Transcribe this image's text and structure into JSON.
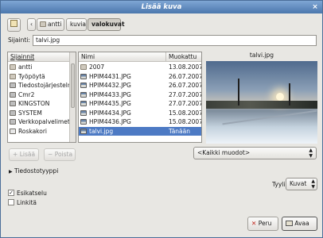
{
  "window": {
    "title": "Lisää kuva"
  },
  "path_bar": {
    "crumbs": [
      "antti",
      "kuvia",
      "valokuvat"
    ],
    "active": "valokuvat"
  },
  "location": {
    "label": "Sijainti:",
    "value": "talvi.jpg"
  },
  "places": {
    "header": "Sijainnit",
    "items": [
      {
        "label": "antti",
        "icon": "home-folder-icon"
      },
      {
        "label": "Työpöytä",
        "icon": "desktop-icon"
      },
      {
        "label": "Tiedostojärjestelm",
        "icon": "filesystem-icon"
      },
      {
        "label": "Cmr2",
        "icon": "drive-icon"
      },
      {
        "label": "KINGSTON",
        "icon": "usb-drive-icon"
      },
      {
        "label": "SYSTEM",
        "icon": "drive-icon"
      },
      {
        "label": "Verkkopalvelimet",
        "icon": "network-icon"
      },
      {
        "label": "Roskakori",
        "icon": "trash-icon"
      }
    ],
    "add_label": "Lisää",
    "remove_label": "Poista"
  },
  "files": {
    "col_name": "Nimi",
    "col_modified": "Muokattu",
    "rows": [
      {
        "name": "2007",
        "modified": "13.08.2007",
        "type": "folder"
      },
      {
        "name": "HPIM4431.JPG",
        "modified": "26.07.2007",
        "type": "image"
      },
      {
        "name": "HPIM4432.JPG",
        "modified": "26.07.2007",
        "type": "image"
      },
      {
        "name": "HPIM4433.JPG",
        "modified": "27.07.2007",
        "type": "image"
      },
      {
        "name": "HPIM4435.JPG",
        "modified": "27.07.2007",
        "type": "image"
      },
      {
        "name": "HPIM4434.JPG",
        "modified": "15.08.2007",
        "type": "image"
      },
      {
        "name": "HPIM4436.JPG",
        "modified": "15.08.2007",
        "type": "image"
      },
      {
        "name": "talvi.jpg",
        "modified": "Tänään",
        "type": "image",
        "selected": true
      }
    ]
  },
  "preview": {
    "title": "talvi.jpg"
  },
  "filter": {
    "value": "<Kaikki muodot>"
  },
  "filetype": {
    "label": "Tiedostotyyppi"
  },
  "style": {
    "label": "Tyyli:",
    "value": "Kuvat"
  },
  "options": {
    "preview_label": "Esikatselu",
    "preview_checked": true,
    "link_label": "Linkitä",
    "link_checked": false
  },
  "actions": {
    "cancel_label": "Peru",
    "open_label": "Avaa"
  },
  "colors": {
    "titlebar": "#5a84b9",
    "selection": "#4d7ac4"
  }
}
